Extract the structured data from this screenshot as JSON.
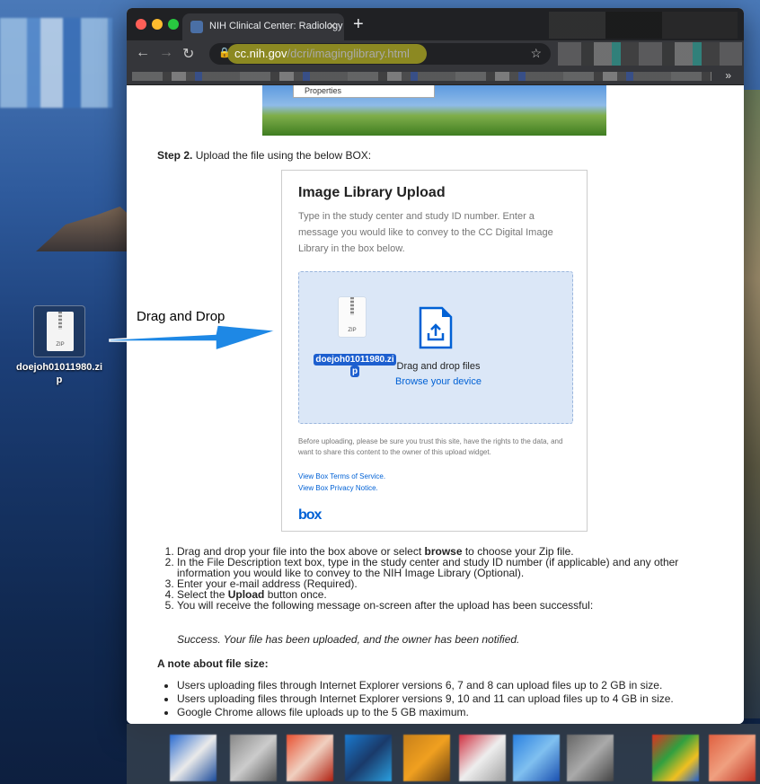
{
  "desktop": {
    "file_name": "doejoh01011980.zip",
    "file_name_line1": "doejoh01011980.zi",
    "file_name_line2": "p",
    "file_icon_label": "ZIP"
  },
  "annotation": {
    "drag_label": "Drag and Drop"
  },
  "browser": {
    "tab_title": "NIH Clinical Center: Radiology Im",
    "url_domain": "cc.nih.gov",
    "url_path": "/dcri/imaginglibrary.html",
    "bookmarks_more": "»"
  },
  "page": {
    "menu_stub": "Properties",
    "step2_bold": "Step 2.",
    "step2_text": " Upload the file using the below BOX:",
    "box": {
      "title": "Image Library Upload",
      "description": "Type in the study center and study ID number. Enter a message you would like to convey to the CC Digital Image Library in the box below.",
      "zip_label": "ZIP",
      "file_line1": "doejoh01011980.zi",
      "file_line2": "p",
      "drop_text": "Drag and drop files",
      "browse_text": "Browse your device",
      "notice": "Before uploading, please be sure you trust this site, have the rights to the data, and want to share this content to the owner of this upload widget.",
      "terms_link": "View Box Terms of Service.",
      "privacy_link": "View Box Privacy Notice.",
      "logo": "box"
    },
    "steps": [
      {
        "pre": "Drag and drop your file into the box above or select ",
        "bold": "browse",
        "post": " to choose your Zip file."
      },
      {
        "pre": "In the File Description text box, type in the study center and study ID number (if applicable) and any other information you would like to convey to the NIH Image Library (Optional).",
        "bold": "",
        "post": ""
      },
      {
        "pre": "Enter your e-mail address (Required).",
        "bold": "",
        "post": ""
      },
      {
        "pre": "Select the ",
        "bold": "Upload",
        "post": " button once."
      },
      {
        "pre": "You will receive the following message on-screen after the upload has been successful:",
        "bold": "",
        "post": ""
      }
    ],
    "success_message": "Success. Your file has been uploaded, and the owner has been notified.",
    "note_heading": "A note about file size:",
    "bullets": [
      "Users uploading files through Internet Explorer versions 6, 7 and 8 can upload files up to 2 GB in size.",
      "Users uploading files through Internet Explorer versions 9, 10 and 11 can upload files up to 4 GB in size.",
      "Google Chrome allows file uploads up to the 5 GB maximum."
    ]
  },
  "colors": {
    "box_blue": "#0061d5",
    "dropzone_bg": "#dbe7f7",
    "url_highlight": "#e6e020",
    "arrow_blue": "#1e88e5"
  }
}
